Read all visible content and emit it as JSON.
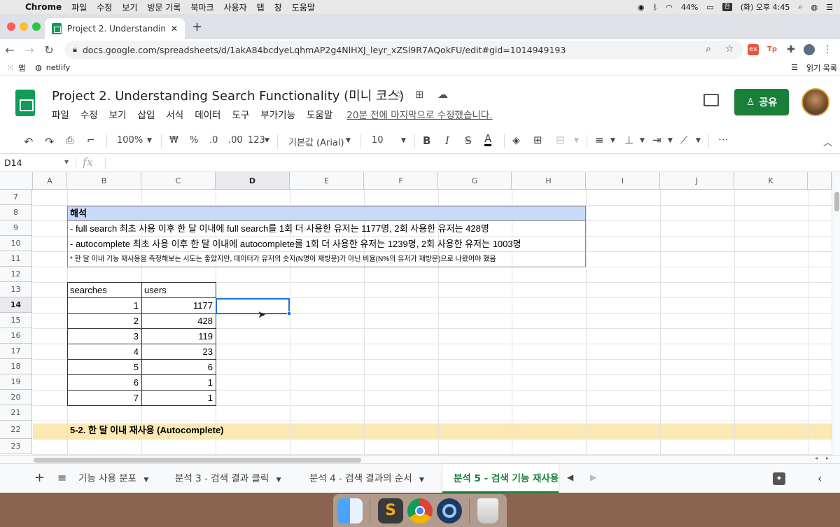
{
  "menubar": {
    "app": "Chrome",
    "items": [
      "파일",
      "수정",
      "보기",
      "방문 기록",
      "북마크",
      "사용자",
      "탭",
      "창",
      "도움말"
    ],
    "battery": "44%",
    "input_method": "한",
    "clock": "(화) 오후 4:45"
  },
  "browser": {
    "tab_title": "Project 2. Understanding Search Functionality",
    "url": "docs.google.com/spreadsheets/d/1akA84bcdyeLqhmAP2g4NlHXJ_leyr_xZSl9R7AQokFU/edit#gid=1014949193",
    "bookmarks": [
      "앱",
      "netlify"
    ],
    "reading_list": "읽기 목록"
  },
  "doc": {
    "title": "Project 2. Understanding Search Functionality (미니 코스)",
    "menus": [
      "파일",
      "수정",
      "보기",
      "삽입",
      "서식",
      "데이터",
      "도구",
      "부가기능",
      "도움말"
    ],
    "last_edit": "20분 전에 마지막으로 수정했습니다.",
    "share_label": "공유"
  },
  "toolbar": {
    "zoom": "100%",
    "currency": "₩",
    "percent": "%",
    "dec_less": ".0",
    "dec_more": ".00",
    "format": "123",
    "font": "기본값 (Arial)",
    "font_size": "10",
    "bold": "B",
    "italic": "I",
    "strike": "S",
    "text_color": "A",
    "more": "⋯"
  },
  "formula_bar": {
    "cell_ref": "D14",
    "fx": "fx",
    "value": ""
  },
  "grid": {
    "columns": [
      "A",
      "B",
      "C",
      "D",
      "E",
      "F",
      "G",
      "H",
      "I",
      "J",
      "K"
    ],
    "selected_column": "D",
    "rows": [
      "7",
      "8",
      "9",
      "10",
      "11",
      "12",
      "13",
      "14",
      "15",
      "16",
      "17",
      "18",
      "19",
      "20",
      "21",
      "22",
      "23"
    ],
    "selected_row": "14",
    "note_title": "해석",
    "note_line1": "- full search 최초 사용 이후 한 달 이내에 full search를 1회 더 사용한 유저는 1177명, 2회 사용한 유저는 428명",
    "note_line2": "- autocomplete 최초 사용 이후 한 달 이내에 autocomplete를 1회 더 사용한 유저는 1239명, 2회 사용한 유저는 1003명",
    "note_line3": "* 한 달 이내 기능 재사용을 측정해보는 시도는 좋았지만, 데이터가 유저의 숫자(N명이 재방문)가 아닌 비율(N%의 유저가 재방문)으로 나왔어야 했음",
    "table_headers": [
      "searches",
      "users"
    ],
    "table_rows": [
      [
        "1",
        "1177"
      ],
      [
        "2",
        "428"
      ],
      [
        "3",
        "119"
      ],
      [
        "4",
        "23"
      ],
      [
        "5",
        "6"
      ],
      [
        "6",
        "1"
      ],
      [
        "7",
        "1"
      ]
    ],
    "section_title": "5-2. 한 달 이내 재사용 (Autocomplete)"
  },
  "sheet_tabs": [
    {
      "label": "기능 사용 분포",
      "active": false
    },
    {
      "label": "분석 3 - 검색 결과 클릭",
      "active": false
    },
    {
      "label": "분석 4 - 검색 결과의 순서",
      "active": false
    },
    {
      "label": "분석 5 - 검색 기능 재사용",
      "active": true
    }
  ],
  "colors": {
    "accent": "#188038",
    "note_header": "#c9daf8",
    "section_band": "#fce8b2",
    "selection": "#1a73e8"
  }
}
